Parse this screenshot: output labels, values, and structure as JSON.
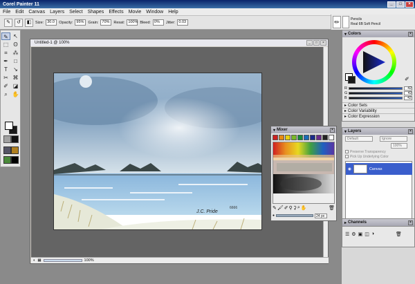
{
  "app": {
    "title": "Corel Painter 11"
  },
  "menu": [
    "File",
    "Edit",
    "Canvas",
    "Layers",
    "Select",
    "Shapes",
    "Effects",
    "Movie",
    "Window",
    "Help"
  ],
  "propbar": {
    "size_label": "Size:",
    "size_value": "30.0",
    "opacity_label": "Opacity:",
    "opacity_value": "95%",
    "grain_label": "Grain:",
    "grain_value": "70%",
    "resat_label": "Resat:",
    "resat_value": "100%",
    "bleed_label": "Bleed:",
    "bleed_value": "0%",
    "jitter_label": "Jitter:",
    "jitter_value": "0.03"
  },
  "brush": {
    "category": "Pencils",
    "variant": "Real 6B Soft Pencil"
  },
  "document": {
    "title": "Untitled-1 @ 100%",
    "zoom": "100%"
  },
  "painting": {
    "signature": "J.C. Pride",
    "year": "6666"
  },
  "colors_panel": {
    "title": "Colors",
    "channels": [
      {
        "label": "R",
        "value": "42"
      },
      {
        "label": "G",
        "value": "42"
      },
      {
        "label": "B",
        "value": "42"
      }
    ],
    "sections": [
      "Color Sets",
      "Color Variability",
      "Color Expression"
    ]
  },
  "mixer": {
    "title": "Mixer",
    "swatches": [
      "#cc2020",
      "#e88a10",
      "#e8d010",
      "#7ab828",
      "#1a8a3a",
      "#1a6ab8",
      "#1a2a8a",
      "#6a2a8a",
      "#222222",
      "#ffffff"
    ],
    "brush_size": "24 px"
  },
  "layers_panel": {
    "title": "Layers",
    "composite_method": "Default",
    "depth": "Ignore",
    "opacity": "100%",
    "preserve_transparency": "Preserve Transparency",
    "pick_up_color": "Pick Up Underlying Color",
    "layer_name": "Canvas"
  },
  "channels_panel": {
    "title": "Channels"
  }
}
